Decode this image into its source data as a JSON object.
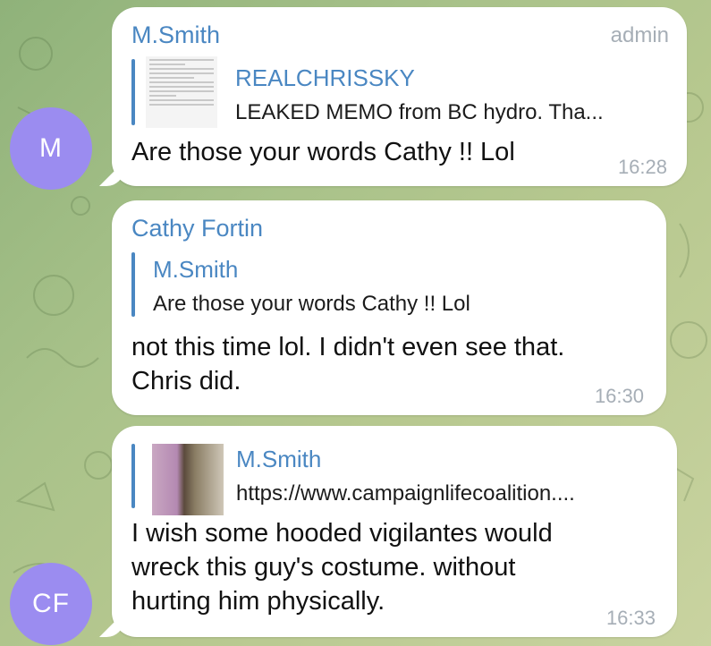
{
  "messages": [
    {
      "sender": "M.Smith",
      "role": "admin",
      "quote": {
        "title": "REALCHRISSKY",
        "text": "LEAKED MEMO from BC hydro.  Tha..."
      },
      "text": "Are those your words Cathy !! Lol",
      "time": "16:28"
    },
    {
      "sender": "Cathy Fortin",
      "quote": {
        "title": "M.Smith",
        "text": "Are those your words Cathy !! Lol"
      },
      "text_lines": [
        "not this time lol. I didn't even see that.",
        "Chris did."
      ],
      "time": "16:30"
    },
    {
      "quote": {
        "title": "M.Smith",
        "text": "https://www.campaignlifecoalition...."
      },
      "text_lines": [
        "I wish some hooded vigilantes would",
        "wreck this guy's costume.  without",
        "hurting him physically."
      ],
      "time": "16:33"
    }
  ],
  "avatars": {
    "m": "M",
    "cf": "CF"
  },
  "colors": {
    "accent": "#4a87c2",
    "avatar": "#9b8cf0",
    "time": "#a6aeb6"
  }
}
